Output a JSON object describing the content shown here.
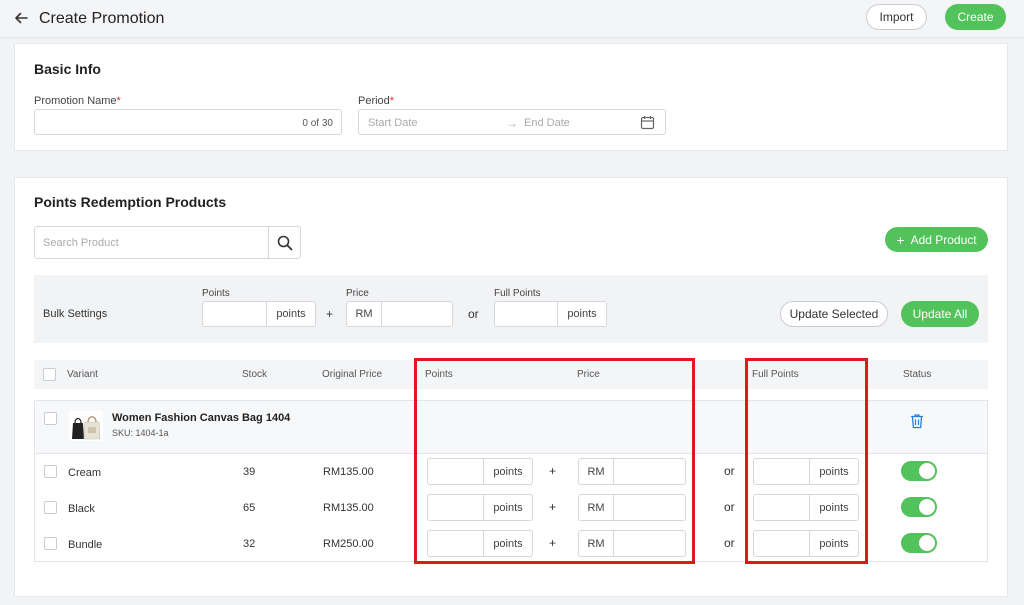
{
  "header": {
    "title": "Create Promotion",
    "import_label": "Import",
    "create_label": "Create"
  },
  "basic_info": {
    "title": "Basic Info",
    "promotion_name_label": "Promotion Name",
    "required_mark": "*",
    "promotion_name_value": "",
    "promotion_name_counter": "0 of 30",
    "period_label": "Period",
    "start_placeholder": "Start Date",
    "end_placeholder": "End Date",
    "arrow": "→"
  },
  "redemption": {
    "title": "Points Redemption Products",
    "search_placeholder": "Search Product",
    "add_product_label": "Add Product",
    "add_plus": "+"
  },
  "bulk": {
    "label": "Bulk Settings",
    "points_label": "Points",
    "price_label": "Price",
    "full_points_label": "Full Points",
    "points_suffix": "points",
    "currency": "RM",
    "plus": "+",
    "or": "or",
    "update_selected_label": "Update Selected",
    "update_all_label": "Update All"
  },
  "table": {
    "columns": {
      "variant": "Variant",
      "stock": "Stock",
      "original_price": "Original Price",
      "points": "Points",
      "price": "Price",
      "full_points": "Full Points",
      "status": "Status"
    },
    "product": {
      "name": "Women Fashion Canvas Bag 1404",
      "sku": "SKU: 1404-1a"
    },
    "rows": [
      {
        "variant": "Cream",
        "stock": "39",
        "original_price": "RM135.00",
        "status_on": true
      },
      {
        "variant": "Black",
        "stock": "65",
        "original_price": "RM135.00",
        "status_on": true
      },
      {
        "variant": "Bundle",
        "stock": "32",
        "original_price": "RM250.00",
        "status_on": true
      }
    ],
    "points_suffix": "points",
    "currency": "RM",
    "plus": "+",
    "or": "or"
  },
  "colors": {
    "accent": "#52c35a",
    "highlight": "#e01818"
  }
}
